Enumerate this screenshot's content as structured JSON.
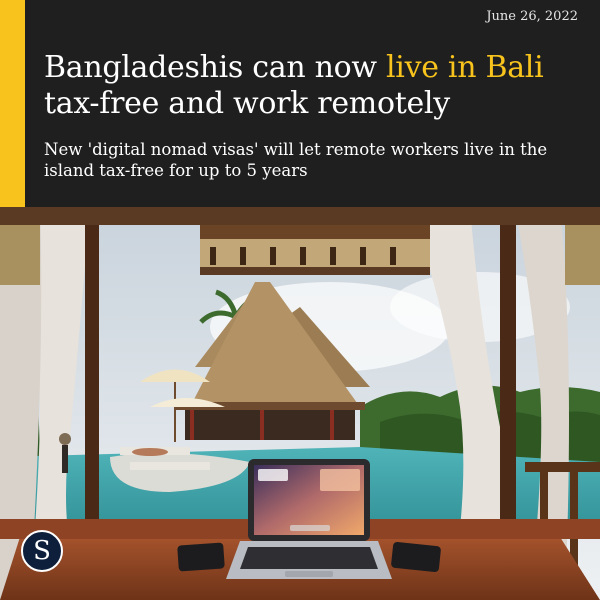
{
  "date": "June 26, 2022",
  "headline": {
    "before": "Bangladeshis can now ",
    "highlight": "live in Bali",
    "after": " tax-free and work remotely"
  },
  "subhead": "New 'digital nomad visas' will let remote workers live in the island tax-free for up to 5 years",
  "logo": {
    "letter": "S"
  },
  "colors": {
    "accent": "#f7c31c",
    "header_bg": "#1f1f1f",
    "logo_bg": "#0e1f3b"
  }
}
